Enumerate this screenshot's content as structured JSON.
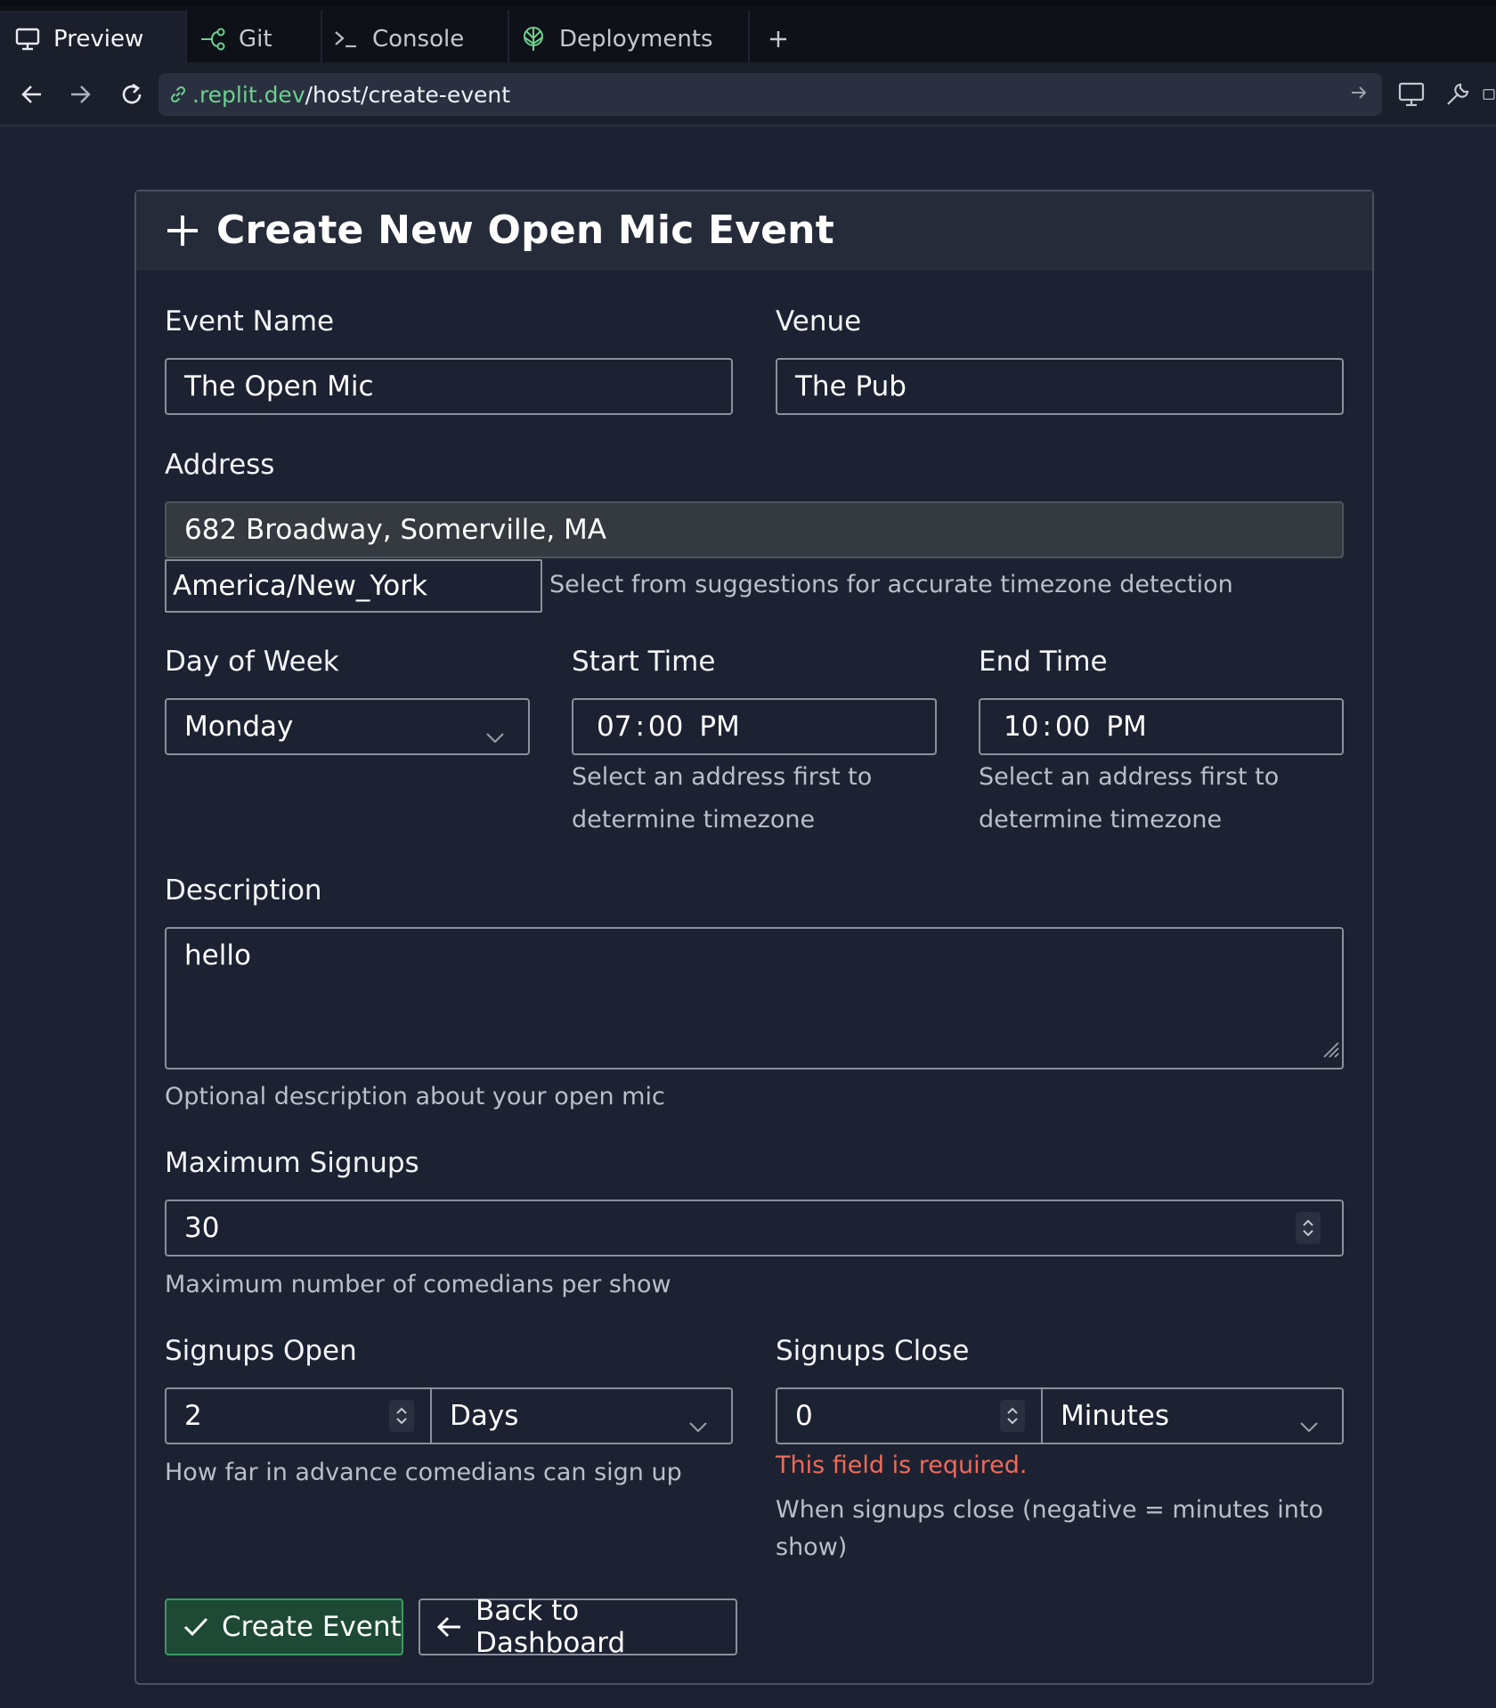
{
  "tabs": [
    {
      "label": "Preview",
      "icon": "monitor-icon",
      "active": true
    },
    {
      "label": "Git",
      "icon": "git-branch-icon",
      "active": false
    },
    {
      "label": "Console",
      "icon": "terminal-icon",
      "active": false
    },
    {
      "label": "Deployments",
      "icon": "deployments-icon",
      "active": false
    }
  ],
  "new_tab_label": "+",
  "address_bar": {
    "domain": ".replit.dev",
    "path": "/host/create-event"
  },
  "form": {
    "title": "Create New Open Mic Event",
    "event_name": {
      "label": "Event Name",
      "value": "The Open Mic"
    },
    "venue": {
      "label": "Venue",
      "value": "The Pub"
    },
    "address": {
      "label": "Address",
      "value": "682 Broadway, Somerville, MA"
    },
    "timezone": {
      "value": "America/New_York",
      "help": "Select from suggestions for accurate timezone detection"
    },
    "day_of_week": {
      "label": "Day of Week",
      "value": "Monday"
    },
    "start_time": {
      "label": "Start Time",
      "hour": "07",
      "minute": "00",
      "period": "PM",
      "help_line1": "Select an address first to",
      "help_line2": "determine timezone"
    },
    "end_time": {
      "label": "End Time",
      "hour": "10",
      "minute": "00",
      "period": "PM",
      "help_line1": "Select an address first to",
      "help_line2": "determine timezone"
    },
    "description": {
      "label": "Description",
      "value": "hello",
      "help": "Optional description about your open mic"
    },
    "max_signups": {
      "label": "Maximum Signups",
      "value": "30",
      "help": "Maximum number of comedians per show"
    },
    "signups_open": {
      "label": "Signups Open",
      "amount": "2",
      "unit": "Days",
      "help": "How far in advance comedians can sign up"
    },
    "signups_close": {
      "label": "Signups Close",
      "amount": "0",
      "unit": "Minutes",
      "error": "This field is required.",
      "help_line1": "When signups close (negative = minutes into",
      "help_line2": "show)"
    },
    "create_button": "Create Event",
    "back_button": "Back to Dashboard"
  },
  "colors": {
    "background": "#1c2231",
    "link_domain": "#6cd08e",
    "error": "#ef6a5a",
    "success_border": "#3b9a62"
  }
}
